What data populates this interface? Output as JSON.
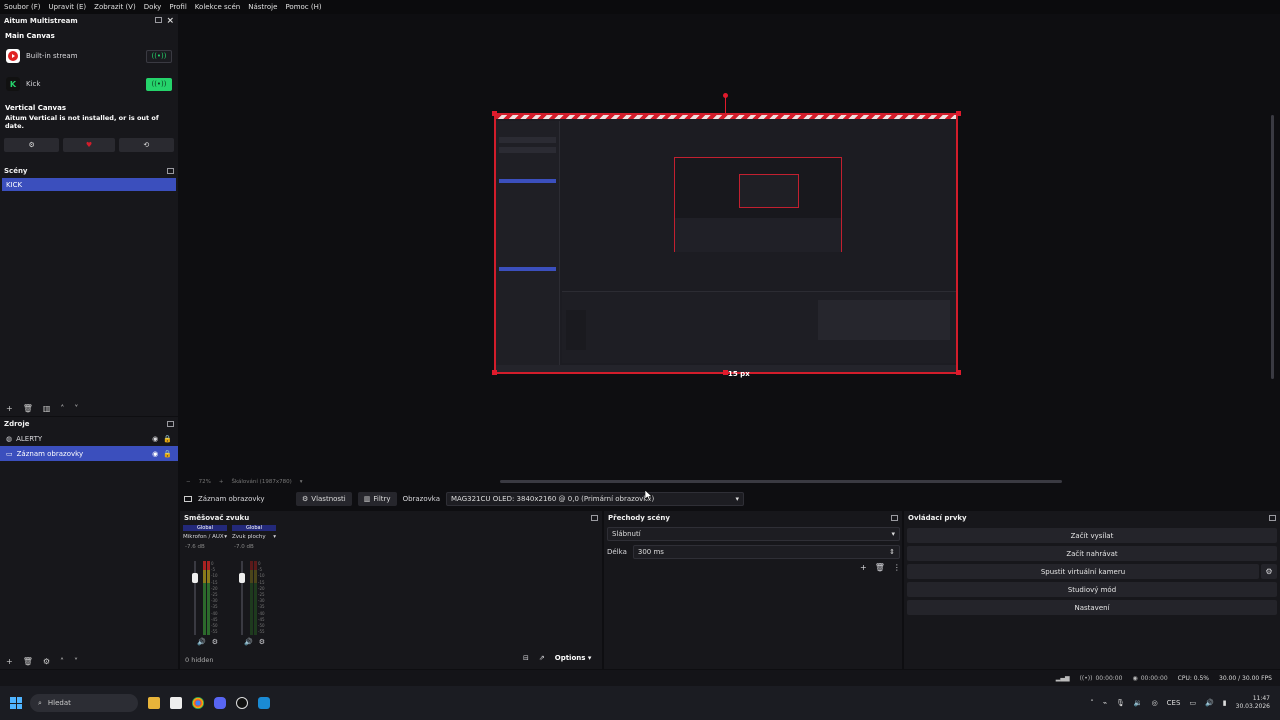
{
  "menu": [
    "Soubor (F)",
    "Upravit (E)",
    "Zobrazit (V)",
    "Doky",
    "Profil",
    "Kolekce scén",
    "Nástroje",
    "Pomoc (H)"
  ],
  "multistream": {
    "title": "Aitum Multistream",
    "main_canvas": "Main Canvas",
    "platforms": [
      {
        "name": "Built-in stream",
        "icon": "youtube-icon",
        "active": false
      },
      {
        "name": "Kick",
        "icon": "kick-icon",
        "active": true
      }
    ],
    "vertical_canvas": "Vertical Canvas",
    "vertical_msg": "Aitum Vertical is not installed, or is out of date."
  },
  "scenes": {
    "title": "Scény",
    "items": [
      "KICK"
    ]
  },
  "sources": {
    "title": "Zdroje",
    "items": [
      "ALERTY",
      "Záznam obrazovky"
    ]
  },
  "preview": {
    "offset_label": "15 px",
    "zoom": "72%",
    "scale_label": "Škálování (1987x780)"
  },
  "source_bar": {
    "source_name": "Záznam obrazovky",
    "properties": "Vlastnosti",
    "filters": "Filtry",
    "display_label": "Obrazovka",
    "display_value": "MAG321CU OLED: 3840x2160 @ 0,0 (Primární obrazovka)"
  },
  "mixer": {
    "title": "Směšovač zvuku",
    "channels": [
      {
        "badge": "Global",
        "name": "Mikrofon / AUX",
        "db": "-7.6 dB"
      },
      {
        "badge": "Global",
        "name": "Zvuk plochy",
        "db": "-7.0 dB"
      }
    ],
    "scale": [
      "0",
      "-5",
      "-10",
      "-15",
      "-20",
      "-25",
      "-30",
      "-35",
      "-40",
      "-45",
      "-50",
      "-55",
      "-60"
    ],
    "hidden": "0 hidden",
    "options": "Options"
  },
  "transitions": {
    "title": "Přechody scény",
    "type": "Slábnutí",
    "duration_label": "Délka",
    "duration": "300 ms"
  },
  "controls": {
    "title": "Ovládací prvky",
    "buttons": [
      "Začít vysílat",
      "Začít nahrávat",
      "Spustit virtuální kameru",
      "Studiový mód",
      "Nastavení"
    ]
  },
  "status": {
    "stream_time": "00:00:00",
    "rec_time": "00:00:00",
    "cpu": "CPU: 0.5%",
    "fps": "30.00 / 30.00 FPS"
  },
  "taskbar": {
    "search": "Hledat",
    "lang": "CES",
    "time": "11:47",
    "date": "30.03.2026"
  },
  "colors": {
    "accent": "#3b4fbd",
    "kick_green": "#25d36b",
    "selection_red": "#d21d2b"
  }
}
